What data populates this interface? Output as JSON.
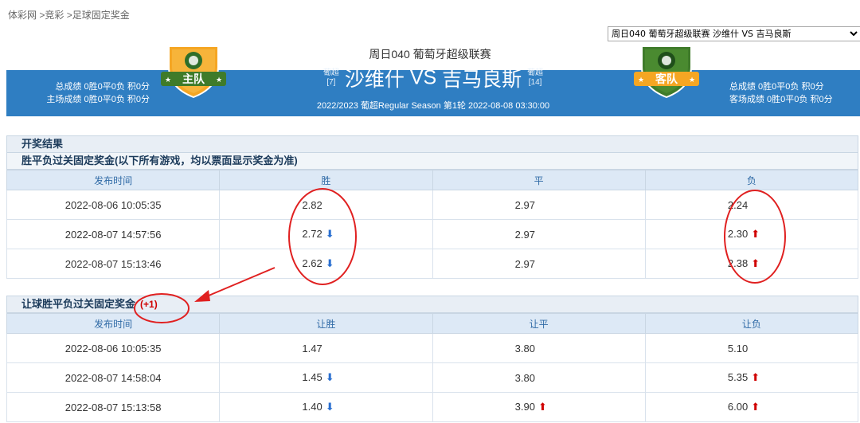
{
  "breadcrumb": [
    "体彩网",
    ">竞彩",
    ">足球固定奖金"
  ],
  "match_select": {
    "selected": "周日040 葡萄牙超级联赛 沙维什 VS 吉马良斯",
    "options": [
      "周日040 葡萄牙超级联赛 沙维什 VS 吉马良斯"
    ]
  },
  "header": {
    "title": "周日040 葡萄牙超级联赛",
    "home": {
      "name": "沙维什",
      "league": "葡超",
      "rank": "[7]",
      "badge": "主队",
      "stats1": "总成绩 0胜0平0负 积0分",
      "stats2": "主场成绩 0胜0平0负 积0分"
    },
    "vs": "VS",
    "away": {
      "name": "吉马良斯",
      "league": "葡超",
      "rank": "[14]",
      "badge": "客队",
      "stats1": "总成绩 0胜0平0负 积0分",
      "stats2": "客场成绩 0胜0平0负 积0分"
    },
    "date_line": "2022/2023 葡超Regular Season 第1轮  2022-08-08  03:30:00"
  },
  "results_title": "开奖结果",
  "section1": {
    "title": "胜平负过关固定奖金(以下所有游戏，均以票面显示奖金为准)",
    "columns": [
      "发布时间",
      "胜",
      "平",
      "负"
    ],
    "rows": [
      {
        "time": "2022-08-06 10:05:35",
        "win": "2.82",
        "draw": "2.97",
        "lose": "2.24",
        "win_trend": "",
        "draw_trend": "",
        "lose_trend": ""
      },
      {
        "time": "2022-08-07 14:57:56",
        "win": "2.72",
        "draw": "2.97",
        "lose": "2.30",
        "win_trend": "down",
        "draw_trend": "",
        "lose_trend": "up"
      },
      {
        "time": "2022-08-07 15:13:46",
        "win": "2.62",
        "draw": "2.97",
        "lose": "2.38",
        "win_trend": "down",
        "draw_trend": "",
        "lose_trend": "up"
      }
    ]
  },
  "section2": {
    "title": "让球胜平负过关固定奖金",
    "handicap": "(+1)",
    "columns": [
      "发布时间",
      "让胜",
      "让平",
      "让负"
    ],
    "rows": [
      {
        "time": "2022-08-06 10:05:35",
        "win": "1.47",
        "draw": "3.80",
        "lose": "5.10",
        "win_trend": "",
        "draw_trend": "",
        "lose_trend": ""
      },
      {
        "time": "2022-08-07 14:58:04",
        "win": "1.45",
        "draw": "3.80",
        "lose": "5.35",
        "win_trend": "down",
        "draw_trend": "",
        "lose_trend": "up"
      },
      {
        "time": "2022-08-07 15:13:58",
        "win": "1.40",
        "draw": "3.90",
        "lose": "6.00",
        "win_trend": "down",
        "draw_trend": "up",
        "lose_trend": "up"
      }
    ]
  },
  "colors": {
    "band": "#2f7ec2",
    "badge_orange": "#f5a623",
    "badge_green": "#3f7b2a",
    "annotation_red": "#e02020"
  },
  "icons": {
    "down": "arrow-down-icon",
    "up": "arrow-up-icon",
    "dropdown": "chevron-down-icon"
  }
}
